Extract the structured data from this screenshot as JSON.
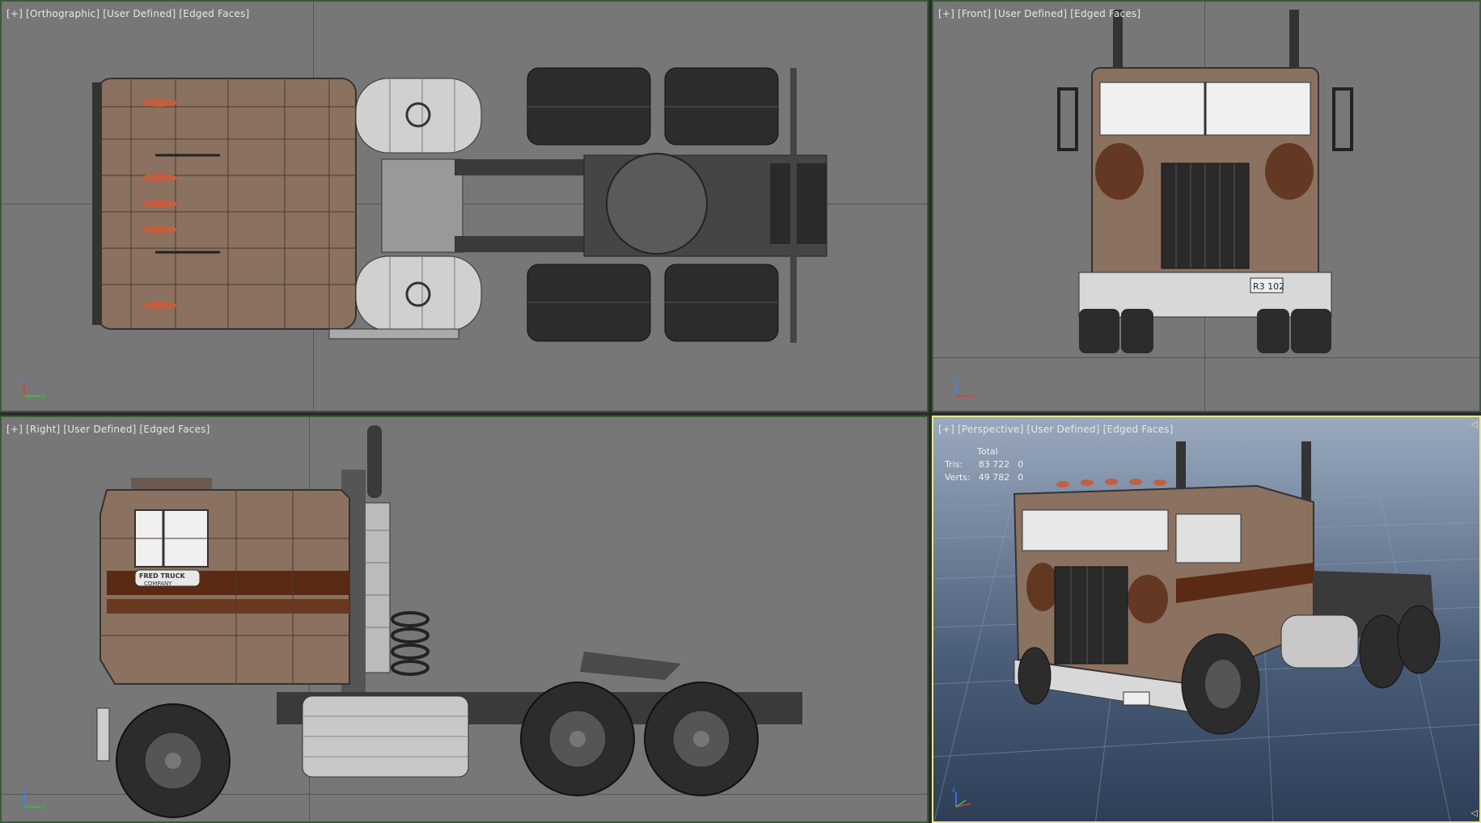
{
  "viewports": {
    "top": {
      "labels": [
        "[+]",
        "[Orthographic]",
        "[User Defined]",
        "[Edged Faces]"
      ]
    },
    "front": {
      "labels": [
        "[+]",
        "[Front]",
        "[User Defined]",
        "[Edged Faces]"
      ]
    },
    "right": {
      "labels": [
        "[+]",
        "[Right]",
        "[User Defined]",
        "[Edged Faces]"
      ]
    },
    "perspective": {
      "labels": [
        "[+]",
        "[Perspective]",
        "[User Defined]",
        "[Edged Faces]"
      ]
    }
  },
  "stats": {
    "header": "Total",
    "tris_label": "Tris:",
    "tris_value": "83 722",
    "tris_sel": "0",
    "verts_label": "Verts:",
    "verts_value": "49 782",
    "verts_sel": "0"
  },
  "model": {
    "door_logo_line1": "FRED TRUCK",
    "door_logo_line2": "COMPANY",
    "plate": "R3 102"
  },
  "axes": {
    "x": "x",
    "y": "y",
    "z": "z"
  },
  "colors": {
    "viewport_bg": "#777777",
    "active_border": "#e8e88a",
    "cab_tan": "#8a7160",
    "stripe_brown": "#5a2a14",
    "tire": "#2c2c2c"
  }
}
